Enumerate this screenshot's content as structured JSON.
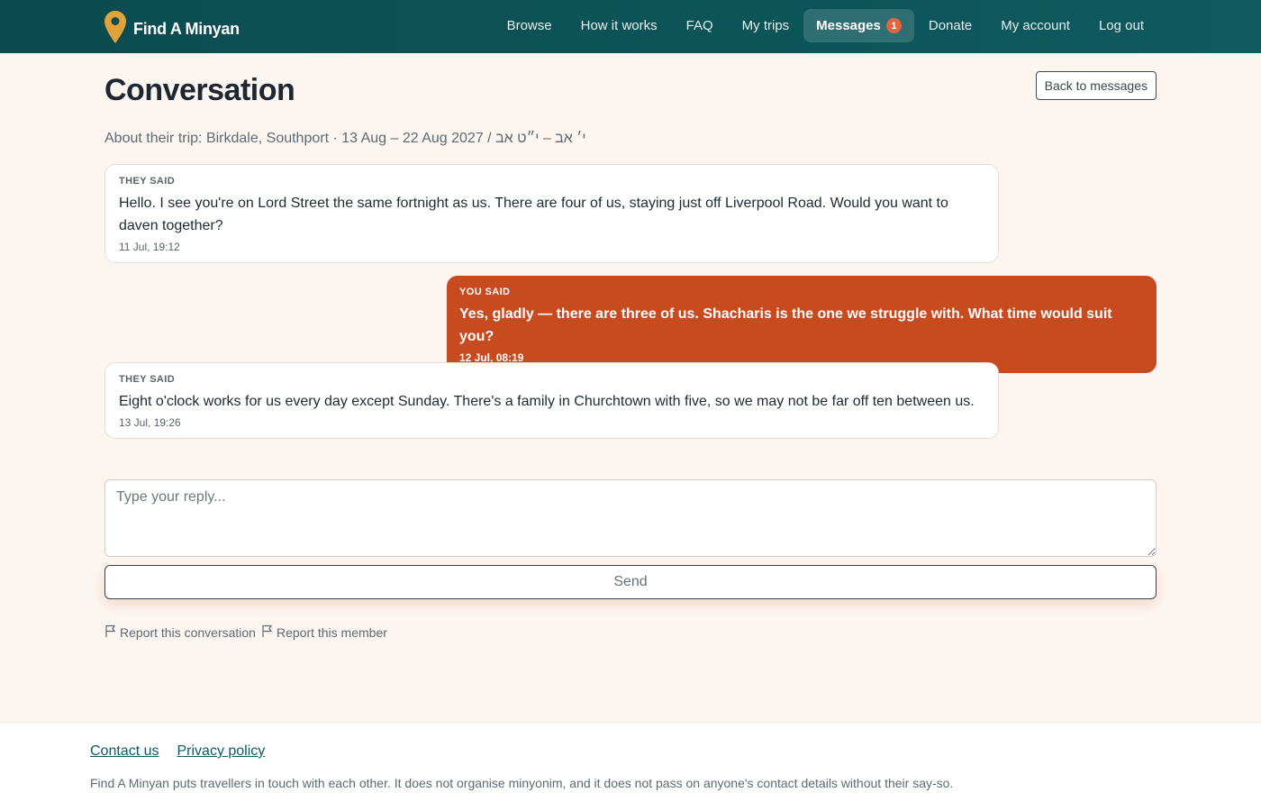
{
  "brand": {
    "name": "Find A Minyan",
    "icon": "map-pin-icon",
    "pin_color": "#e2a23a"
  },
  "nav": [
    {
      "label": "Browse"
    },
    {
      "label": "How it works"
    },
    {
      "label": "FAQ"
    },
    {
      "label": "My trips"
    },
    {
      "label": "Messages",
      "badge": "1",
      "active": true
    },
    {
      "label": "Donate"
    },
    {
      "label": "My account"
    },
    {
      "label": "Log out"
    }
  ],
  "page": {
    "title": "Conversation",
    "back_label": "Back to messages",
    "trip_info": "About their trip: Birkdale, Southport · 13 Aug – 22 Aug 2027 / י׳ אב – י״ט אב"
  },
  "messages": [
    {
      "who": "THEY SAID",
      "body": "Hello. I see you're on Lord Street the same fortnight as us. There are four of us, staying just off Liverpool Road. Would you want to daven together?",
      "time": "11 Jul, 19:12"
    },
    {
      "who": "YOU SAID",
      "body": "Yes, gladly — there are three of us. Shacharis is the one we struggle with. What time would suit you?",
      "time": "12 Jul, 08:19"
    },
    {
      "who": "THEY SAID",
      "body": "Eight o'clock works for us every day except Sunday. There's a family in Churchtown with five, so we may not be far off ten between us.",
      "time": "13 Jul, 19:26"
    }
  ],
  "reply": {
    "placeholder": "Type your reply...",
    "value": ""
  },
  "send_label": "Send",
  "reports": {
    "conversation": "Report this conversation",
    "member": "Report this member",
    "icon": "flag-icon"
  },
  "footer": {
    "contact": "Contact us",
    "privacy": "Privacy policy",
    "note": "Find A Minyan puts travellers in touch with each other. It does not organise minyonim, and it does not pass on anyone's contact details without their say-so."
  },
  "colors": {
    "header": "#0e5a5f",
    "accent": "#c84a1f",
    "badge": "#e2653f",
    "page_bg": "#fdf6f0"
  }
}
